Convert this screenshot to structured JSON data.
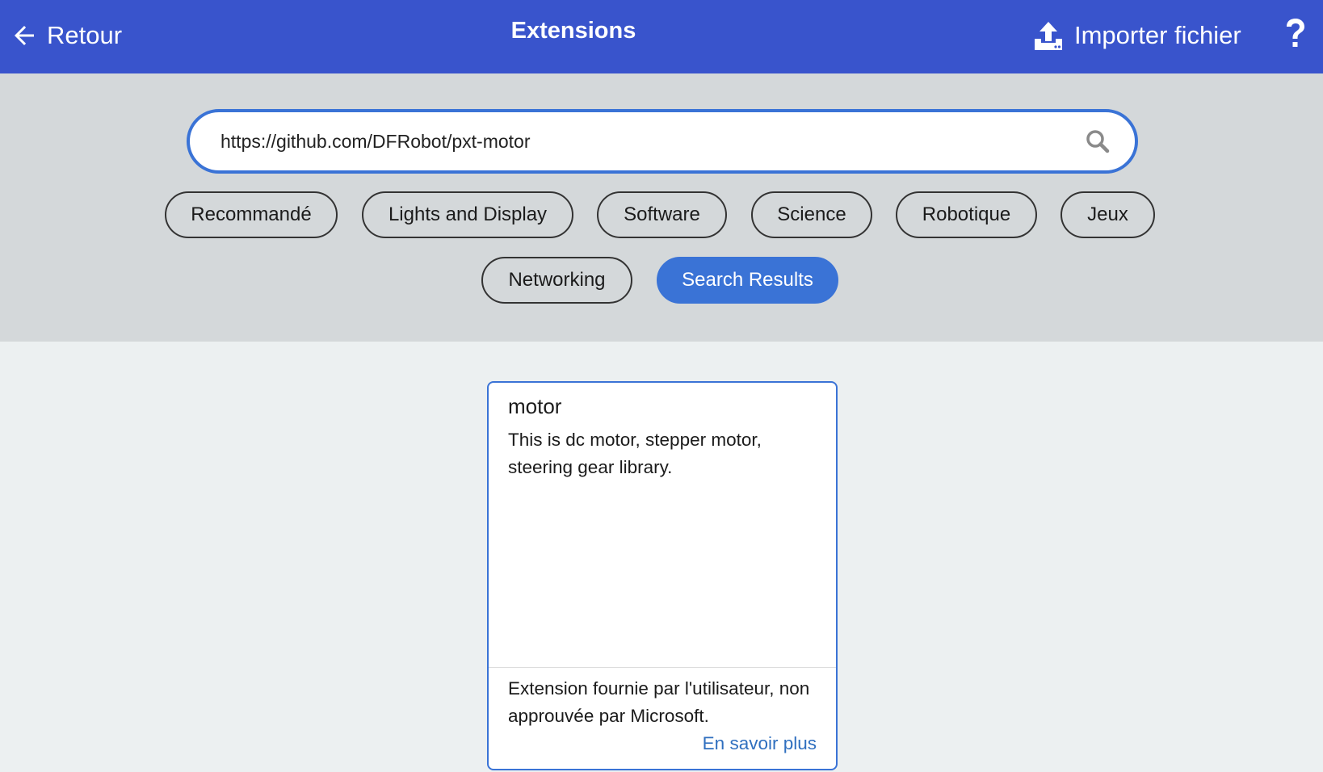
{
  "header": {
    "back_label": "Retour",
    "title": "Extensions",
    "import_label": "Importer fichier",
    "help_symbol": "?",
    "background_color": "#3954cc"
  },
  "search": {
    "value": "https://github.com/DFRobot/pxt-motor",
    "icon": "search-icon",
    "accent_color": "#3a73d6"
  },
  "categories": [
    {
      "label": "Recommandé",
      "active": false
    },
    {
      "label": "Lights and Display",
      "active": false
    },
    {
      "label": "Software",
      "active": false
    },
    {
      "label": "Science",
      "active": false
    },
    {
      "label": "Robotique",
      "active": false
    },
    {
      "label": "Jeux",
      "active": false
    },
    {
      "label": "Networking",
      "active": false
    },
    {
      "label": "Search Results",
      "active": true
    }
  ],
  "card": {
    "title": "motor",
    "description": "This is dc motor, stepper motor, steering gear library.",
    "footer_text": "Extension fournie par l'utilisateur, non approuvée par Microsoft.",
    "learn_more": "En savoir plus",
    "link_color": "#2f6fbf"
  }
}
